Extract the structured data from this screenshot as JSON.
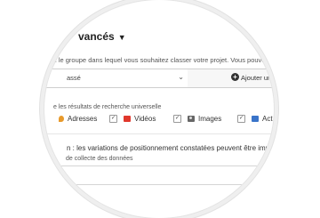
{
  "advanced": {
    "section_title": "vancés",
    "group_hint": "z le groupe dans lequel vous souhaitez classer votre projet. Vous pouvez e",
    "group_select_value": "assé",
    "add_button_label": "Ajouter un"
  },
  "universal": {
    "hint": "e les résultats de recherche universelle",
    "options": [
      {
        "label": "Adresses",
        "checked": true
      },
      {
        "label": "Vidéos",
        "checked": true
      },
      {
        "label": "Images",
        "checked": true
      },
      {
        "label": "Act",
        "checked": true
      }
    ]
  },
  "note": {
    "text": "n : les variations de positionnement constatées peuvent être importante",
    "subtext": "de collecte des données"
  },
  "icons": {
    "adresses": "map-pin-icon",
    "videos": "video-icon",
    "images": "camera-icon",
    "act": "news-icon"
  },
  "colors": {
    "video_icon": "#e0382c",
    "act_icon": "#3a74c9",
    "pin_icon": "#e89a2b"
  }
}
